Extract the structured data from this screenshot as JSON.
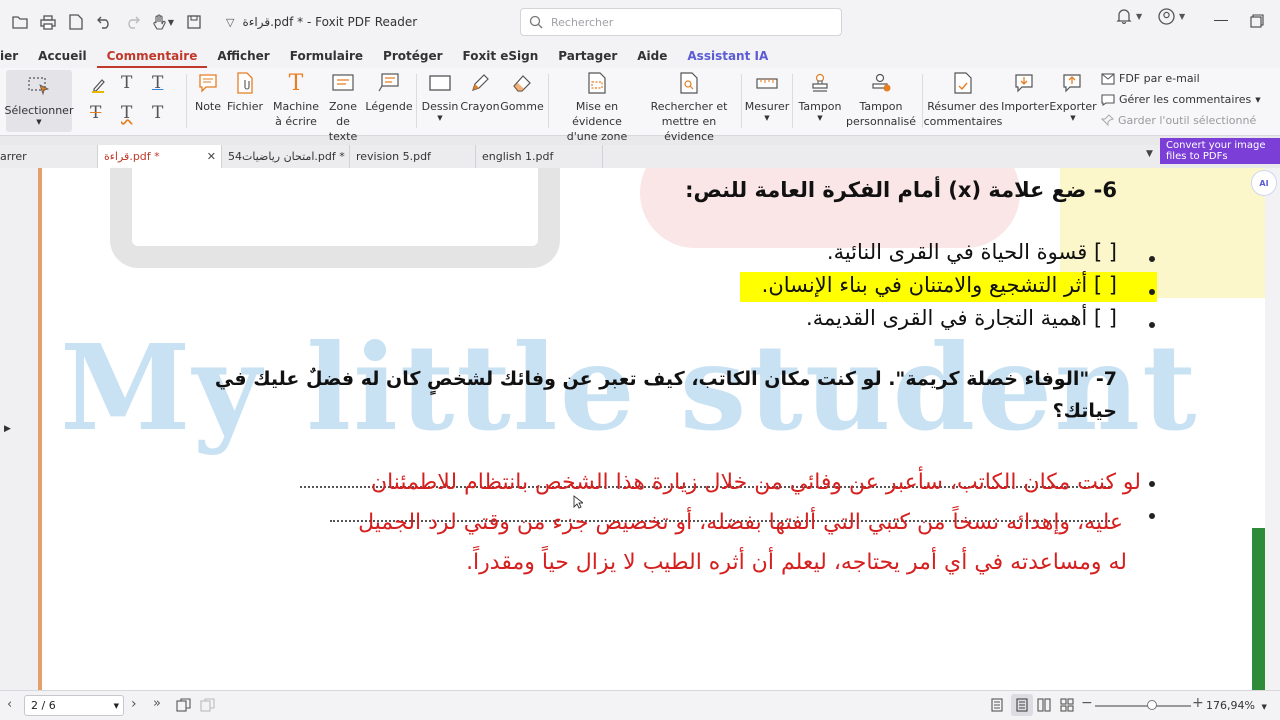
{
  "titlebar": {
    "title": "قراءة.pdf * - Foxit PDF Reader",
    "search_placeholder": "Rechercher"
  },
  "ribbon_tabs": [
    "ier",
    "Accueil",
    "Commentaire",
    "Afficher",
    "Formulaire",
    "Protéger",
    "Foxit eSign",
    "Partager",
    "Aide",
    "Assistant IA"
  ],
  "ribbon": {
    "select": "Sélectionner",
    "note": "Note",
    "file": "Fichier",
    "typewriter": [
      "Machine",
      "à écrire"
    ],
    "textbox": [
      "Zone",
      "de texte"
    ],
    "callout": "Légende",
    "drawing": "Dessin",
    "pencil": "Crayon",
    "eraser": "Gomme",
    "highlight_area": [
      "Mise en évidence",
      "d'une zone"
    ],
    "search_highlight": [
      "Rechercher et",
      "mettre en évidence"
    ],
    "measure": "Mesurer",
    "stamp": "Tampon",
    "custom_stamp": [
      "Tampon",
      "personnalisé"
    ],
    "summarize": [
      "Résumer des",
      "commentaires"
    ],
    "import": "Importer",
    "export": "Exporter",
    "fdf_email": "FDF par e-mail",
    "manage_comments": "Gérer les commentaires",
    "keep_tool": "Garder l'outil sélectionné"
  },
  "doc_tabs": [
    "arrer",
    "قراءة.pdf *",
    "امتحان رياضيات54.pdf *",
    "revision 5.pdf",
    "english 1.pdf"
  ],
  "convert_banner": "Convert your image files to PDFs",
  "document": {
    "q6": "6- ضع علامة (x) أمام الفكرة العامة للنص:",
    "opt1": "[ ] قسوة الحياة في القرى النائية.",
    "opt2": "[ ] أثر التشجيع والامتنان في بناء الإنسان.",
    "opt3": "[ ] أهمية التجارة في القرى القديمة.",
    "q7_line1": "7- \"الوفاء خصلة كريمة\". لو كنت مكان الكاتب، كيف تعبر عن وفائك لشخصٍ كان له فضلٌ عليك في",
    "q7_line2": "حياتك؟",
    "ans_line1": "لو كنت مكان الكاتب، سأعبر عن وفائي من خلال زيارة هذا الشخص بانتظام للاطمئنان",
    "ans_line2": "عليه، وإهدائه نسخاً من كتبي التي ألفتها بفضله، أو تخصيص جزء من وقتي لرد الجميل",
    "ans_line3": "له ومساعدته في أي أمر يحتاجه، ليعلم أن أثره الطيب لا يزال حياً ومقدراً.",
    "watermark": "My little student"
  },
  "statusbar": {
    "page": "2 / 6",
    "zoom": "176,94%"
  },
  "colors": {
    "accent": "#c0392b",
    "highlight": "#ffff00",
    "answer_red": "#d62020",
    "watermark": "#b8d9ef"
  }
}
